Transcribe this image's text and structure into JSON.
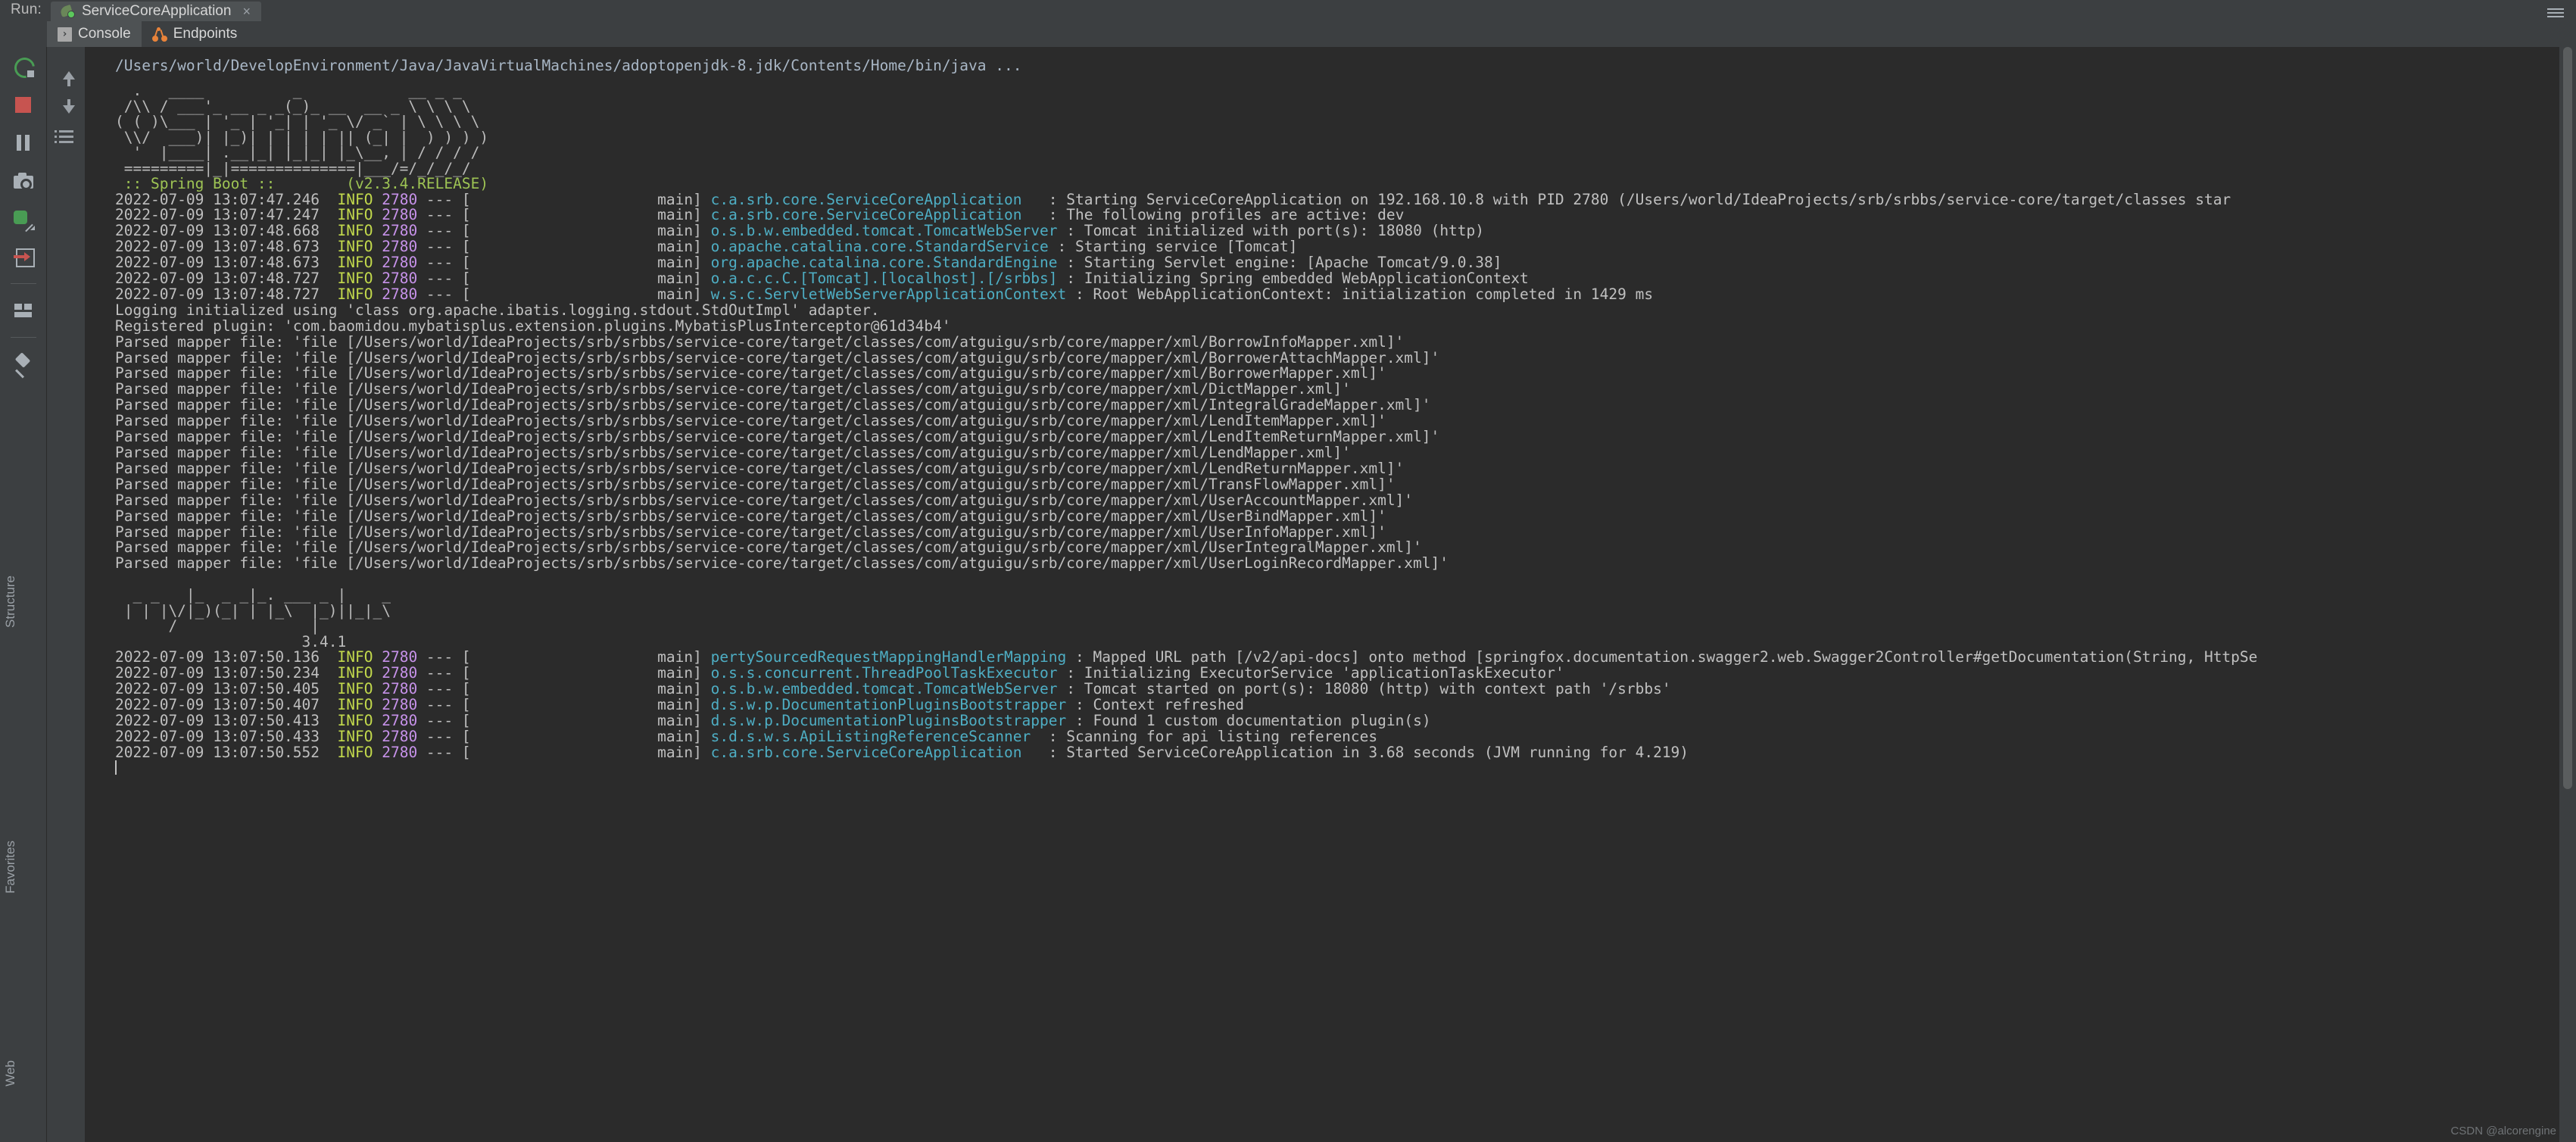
{
  "window": {
    "run_label": "Run:",
    "run_tab_title": "ServiceCoreApplication",
    "close_glyph": "×"
  },
  "tabs": [
    {
      "label": "Console",
      "icon": "console-icon",
      "active": true
    },
    {
      "label": "Endpoints",
      "icon": "endpoints-icon",
      "active": false
    }
  ],
  "toolbar_left": [
    {
      "name": "rerun-button",
      "title": "Rerun"
    },
    {
      "name": "stop-button",
      "title": "Stop"
    },
    {
      "name": "pause-button",
      "title": "Pause Output"
    },
    {
      "name": "camera-button",
      "title": "Dump Threads"
    },
    {
      "name": "thread-dump-button",
      "title": "Thread Dump"
    },
    {
      "name": "exit-button",
      "title": "Exit"
    },
    {
      "name": "soft-wrap-button",
      "title": "Soft-Wrap"
    },
    {
      "name": "clear-all-button",
      "title": "Clear All"
    },
    {
      "name": "pin-tab-button",
      "title": "Pin Tab"
    }
  ],
  "toolbar_gutter": [
    {
      "name": "scroll-up-button",
      "title": "Up the Stack Trace"
    },
    {
      "name": "scroll-down-button",
      "title": "Down the Stack Trace"
    },
    {
      "name": "print-button",
      "title": "Print"
    }
  ],
  "console": {
    "command_line": "/Users/world/DevelopEnvironment/Java/JavaVirtualMachines/adoptopenjdk-8.jdk/Contents/Home/bin/java ...",
    "spring_banner": "  .   ____          _            __ _ _\n /\\\\ / ___'_ __ _ _(_)_ __  __ _ \\ \\ \\ \\\n( ( )\\___ | '_ | '_| | '_ \\/ _` | \\ \\ \\ \\\n \\\\/  ___)| |_)| | | | | || (_| |  ) ) ) )\n  '  |____| .__|_| |_|_| |_\\__, | / / / /\n =========|_|==============|___/=/_/_/_/",
    "spring_boot_tag": " :: Spring Boot ::        (v2.3.4.RELEASE)",
    "spring_version": "(v2.3.4.RELEASE)",
    "mybatis_banner": "  _ _   |_  _ _|_. ___ _ |    _\n | | |\\/|_)(_| | |_\\  |_)||_|_\\\n      /               |\n                     3.4.1 ",
    "mybatis_version": "3.4.1",
    "caret_visible": true,
    "log_pid": "2780",
    "log_level": "INFO",
    "log_thread": "main",
    "lines": [
      {
        "type": "log",
        "ts": "2022-07-09 13:07:47.246",
        "level": "INFO",
        "pid": "2780",
        "thread": "main",
        "logger": "c.a.srb.core.ServiceCoreApplication",
        "logger_pad": 37,
        "msg": "Starting ServiceCoreApplication on 192.168.10.8 with PID 2780 (/Users/world/IdeaProjects/srb/srbbs/service-core/target/classes star"
      },
      {
        "type": "log",
        "ts": "2022-07-09 13:07:47.247",
        "level": "INFO",
        "pid": "2780",
        "thread": "main",
        "logger": "c.a.srb.core.ServiceCoreApplication",
        "logger_pad": 37,
        "msg": "The following profiles are active: dev"
      },
      {
        "type": "log",
        "ts": "2022-07-09 13:07:48.668",
        "level": "INFO",
        "pid": "2780",
        "thread": "main",
        "logger": "o.s.b.w.embedded.tomcat.TomcatWebServer",
        "logger_pad": 37,
        "msg": "Tomcat initialized with port(s): 18080 (http)"
      },
      {
        "type": "log",
        "ts": "2022-07-09 13:07:48.673",
        "level": "INFO",
        "pid": "2780",
        "thread": "main",
        "logger": "o.apache.catalina.core.StandardService",
        "logger_pad": 37,
        "msg": "Starting service [Tomcat]"
      },
      {
        "type": "log",
        "ts": "2022-07-09 13:07:48.673",
        "level": "INFO",
        "pid": "2780",
        "thread": "main",
        "logger": "org.apache.catalina.core.StandardEngine",
        "logger_pad": 37,
        "msg": "Starting Servlet engine: [Apache Tomcat/9.0.38]"
      },
      {
        "type": "log",
        "ts": "2022-07-09 13:07:48.727",
        "level": "INFO",
        "pid": "2780",
        "thread": "main",
        "logger": "o.a.c.c.C.[Tomcat].[localhost].[/srbbs]",
        "logger_pad": 37,
        "msg": "Initializing Spring embedded WebApplicationContext"
      },
      {
        "type": "log",
        "ts": "2022-07-09 13:07:48.727",
        "level": "INFO",
        "pid": "2780",
        "thread": "main",
        "logger": "w.s.c.ServletWebServerApplicationContext",
        "logger_pad": 37,
        "msg": "Root WebApplicationContext: initialization completed in 1429 ms"
      },
      {
        "type": "plain",
        "text": "Logging initialized using 'class org.apache.ibatis.logging.stdout.StdOutImpl' adapter."
      },
      {
        "type": "plain",
        "text": "Registered plugin: 'com.baomidou.mybatisplus.extension.plugins.MybatisPlusInterceptor@61d34b4'"
      },
      {
        "type": "plain",
        "text": "Parsed mapper file: 'file [/Users/world/IdeaProjects/srb/srbbs/service-core/target/classes/com/atguigu/srb/core/mapper/xml/BorrowInfoMapper.xml]'"
      },
      {
        "type": "plain",
        "text": "Parsed mapper file: 'file [/Users/world/IdeaProjects/srb/srbbs/service-core/target/classes/com/atguigu/srb/core/mapper/xml/BorrowerAttachMapper.xml]'"
      },
      {
        "type": "plain",
        "text": "Parsed mapper file: 'file [/Users/world/IdeaProjects/srb/srbbs/service-core/target/classes/com/atguigu/srb/core/mapper/xml/BorrowerMapper.xml]'"
      },
      {
        "type": "plain",
        "text": "Parsed mapper file: 'file [/Users/world/IdeaProjects/srb/srbbs/service-core/target/classes/com/atguigu/srb/core/mapper/xml/DictMapper.xml]'"
      },
      {
        "type": "plain",
        "text": "Parsed mapper file: 'file [/Users/world/IdeaProjects/srb/srbbs/service-core/target/classes/com/atguigu/srb/core/mapper/xml/IntegralGradeMapper.xml]'"
      },
      {
        "type": "plain",
        "text": "Parsed mapper file: 'file [/Users/world/IdeaProjects/srb/srbbs/service-core/target/classes/com/atguigu/srb/core/mapper/xml/LendItemMapper.xml]'"
      },
      {
        "type": "plain",
        "text": "Parsed mapper file: 'file [/Users/world/IdeaProjects/srb/srbbs/service-core/target/classes/com/atguigu/srb/core/mapper/xml/LendItemReturnMapper.xml]'"
      },
      {
        "type": "plain",
        "text": "Parsed mapper file: 'file [/Users/world/IdeaProjects/srb/srbbs/service-core/target/classes/com/atguigu/srb/core/mapper/xml/LendMapper.xml]'"
      },
      {
        "type": "plain",
        "text": "Parsed mapper file: 'file [/Users/world/IdeaProjects/srb/srbbs/service-core/target/classes/com/atguigu/srb/core/mapper/xml/LendReturnMapper.xml]'"
      },
      {
        "type": "plain",
        "text": "Parsed mapper file: 'file [/Users/world/IdeaProjects/srb/srbbs/service-core/target/classes/com/atguigu/srb/core/mapper/xml/TransFlowMapper.xml]'"
      },
      {
        "type": "plain",
        "text": "Parsed mapper file: 'file [/Users/world/IdeaProjects/srb/srbbs/service-core/target/classes/com/atguigu/srb/core/mapper/xml/UserAccountMapper.xml]'"
      },
      {
        "type": "plain",
        "text": "Parsed mapper file: 'file [/Users/world/IdeaProjects/srb/srbbs/service-core/target/classes/com/atguigu/srb/core/mapper/xml/UserBindMapper.xml]'"
      },
      {
        "type": "plain",
        "text": "Parsed mapper file: 'file [/Users/world/IdeaProjects/srb/srbbs/service-core/target/classes/com/atguigu/srb/core/mapper/xml/UserInfoMapper.xml]'"
      },
      {
        "type": "plain",
        "text": "Parsed mapper file: 'file [/Users/world/IdeaProjects/srb/srbbs/service-core/target/classes/com/atguigu/srb/core/mapper/xml/UserIntegralMapper.xml]'"
      },
      {
        "type": "plain",
        "text": "Parsed mapper file: 'file [/Users/world/IdeaProjects/srb/srbbs/service-core/target/classes/com/atguigu/srb/core/mapper/xml/UserLoginRecordMapper.xml]'"
      },
      {
        "type": "blank"
      },
      {
        "type": "banner2"
      },
      {
        "type": "log",
        "ts": "2022-07-09 13:07:50.136",
        "level": "INFO",
        "pid": "2780",
        "thread": "main",
        "logger": "pertySourcedRequestMappingHandlerMapping",
        "logger_pad": 37,
        "msg": "Mapped URL path [/v2/api-docs] onto method [springfox.documentation.swagger2.web.Swagger2Controller#getDocumentation(String, HttpSe"
      },
      {
        "type": "log",
        "ts": "2022-07-09 13:07:50.234",
        "level": "INFO",
        "pid": "2780",
        "thread": "main",
        "logger": "o.s.s.concurrent.ThreadPoolTaskExecutor",
        "logger_pad": 37,
        "msg": "Initializing ExecutorService 'applicationTaskExecutor'"
      },
      {
        "type": "log",
        "ts": "2022-07-09 13:07:50.405",
        "level": "INFO",
        "pid": "2780",
        "thread": "main",
        "logger": "o.s.b.w.embedded.tomcat.TomcatWebServer",
        "logger_pad": 37,
        "msg": "Tomcat started on port(s): 18080 (http) with context path '/srbbs'"
      },
      {
        "type": "log",
        "ts": "2022-07-09 13:07:50.407",
        "level": "INFO",
        "pid": "2780",
        "thread": "main",
        "logger": "d.s.w.p.DocumentationPluginsBootstrapper",
        "logger_pad": 37,
        "msg": "Context refreshed"
      },
      {
        "type": "log",
        "ts": "2022-07-09 13:07:50.413",
        "level": "INFO",
        "pid": "2780",
        "thread": "main",
        "logger": "d.s.w.p.DocumentationPluginsBootstrapper",
        "logger_pad": 37,
        "msg": "Found 1 custom documentation plugin(s)"
      },
      {
        "type": "log",
        "ts": "2022-07-09 13:07:50.433",
        "level": "INFO",
        "pid": "2780",
        "thread": "main",
        "logger": "s.d.s.w.s.ApiListingReferenceScanner",
        "logger_pad": 37,
        "msg": "Scanning for api listing references"
      },
      {
        "type": "log",
        "ts": "2022-07-09 13:07:50.552",
        "level": "INFO",
        "pid": "2780",
        "thread": "main",
        "logger": "c.a.srb.core.ServiceCoreApplication",
        "logger_pad": 37,
        "msg": "Started ServiceCoreApplication in 3.68 seconds (JVM running for 4.219)"
      },
      {
        "type": "caret"
      }
    ]
  },
  "side_stripes": [
    {
      "label": "Structure",
      "name": "tool-window-structure"
    },
    {
      "label": "Favorites",
      "name": "tool-window-favorites"
    },
    {
      "label": "Web",
      "name": "tool-window-web"
    }
  ],
  "watermark": "CSDN @alcorengine",
  "colors": {
    "console_bg": "#2b2b2b",
    "chrome_bg": "#3c3f41",
    "level": "#c2d94c",
    "pid": "#c792ea",
    "logger": "#4eaec4",
    "text": "#c0c0c0",
    "green": "#9ec454",
    "stop_red": "#c75450"
  }
}
